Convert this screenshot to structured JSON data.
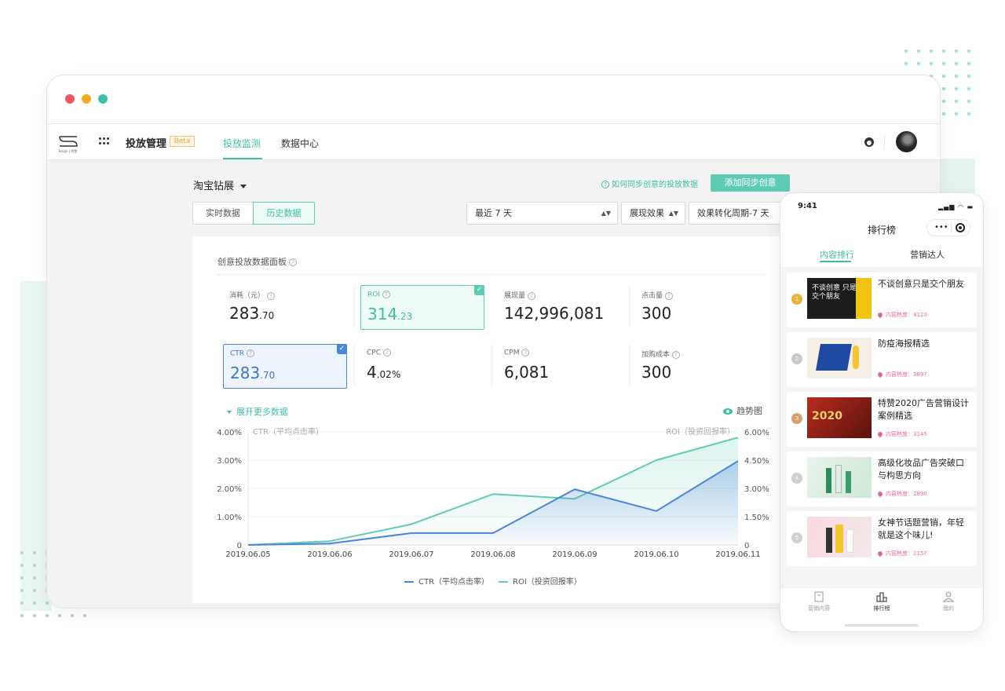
{
  "colors": {
    "accent": "#3cbfa4",
    "ctr_line": "#4a86da",
    "roi_line": "#5fcbb4",
    "heat": "#e46a8f"
  },
  "nav": {
    "brand": "投放管理",
    "badge": "Beta",
    "tabs": [
      {
        "label": "投放监测",
        "active": true
      },
      {
        "label": "数据中心",
        "active": false
      }
    ],
    "logo_text": "Tezign | 特赞"
  },
  "toolbar": {
    "store": "淘宝钻展",
    "help_link": "如何同步创意的投放数据",
    "add_button": "添加同步创意",
    "segments": [
      {
        "label": "实时数据",
        "active": false
      },
      {
        "label": "历史数据",
        "active": true
      }
    ],
    "selects": [
      "最近 7 天",
      "展现效果",
      "效果转化周期-7 天"
    ]
  },
  "panel": {
    "title": "创意投放数据面板",
    "metrics": [
      {
        "label": "消耗（元）",
        "int": "283",
        "dec": ".70",
        "state": "none"
      },
      {
        "label": "ROI",
        "int": "314",
        "dec": ".23",
        "state": "green"
      },
      {
        "label": "展现量",
        "int": "142,996,081",
        "dec": "",
        "state": "none"
      },
      {
        "label": "点击量",
        "int": "300",
        "dec": "",
        "state": "none"
      },
      {
        "label": "CTR",
        "int": "283",
        "dec": ".70",
        "state": "blue"
      },
      {
        "label": "CPC",
        "int": "4",
        "dec": ".02%",
        "state": "none"
      },
      {
        "label": "CPM",
        "int": "6,081",
        "dec": "",
        "state": "none"
      },
      {
        "label": "加购成本",
        "int": "300",
        "dec": "",
        "state": "none"
      }
    ],
    "expand_label": "展开更多数据",
    "trend_label": "趋势图"
  },
  "chart_data": {
    "type": "line",
    "x": [
      "2019.06.05",
      "2019.06.06",
      "2019.06.07",
      "2019.06.08",
      "2019.06.09",
      "2019.06.10",
      "2019.06.11"
    ],
    "series": [
      {
        "name": "CTR（平均点击率）",
        "axis": "left",
        "values": [
          0.0,
          0.05,
          0.42,
          0.42,
          1.97,
          1.2,
          2.97
        ]
      },
      {
        "name": "ROI（投资回报率）",
        "axis": "right",
        "values": [
          0.0,
          0.2,
          1.1,
          2.7,
          2.45,
          4.5,
          5.7
        ]
      }
    ],
    "ylabel_left": "CTR（平均点击率）",
    "ylabel_right": "ROI（投资回报率）",
    "yticks_left": [
      "0",
      "1.00%",
      "2.00%",
      "3.00%",
      "4.00%"
    ],
    "yticks_right": [
      "0",
      "1.50%",
      "3.00%",
      "4.50%",
      "6.00%"
    ],
    "ylim_left": [
      0,
      4
    ],
    "ylim_right": [
      0,
      6
    ],
    "grid": true,
    "legend": "bottom"
  },
  "phone": {
    "time": "9:41",
    "title": "排行榜",
    "capsule_more": "•••",
    "tabs": [
      {
        "label": "内容排行",
        "active": true
      },
      {
        "label": "营销达人",
        "active": false
      }
    ],
    "items": [
      {
        "rank": "1",
        "title": "不谈创意只是交个朋友",
        "heat": "内容热度：4120",
        "thumb_text": "不谈创意 只是交个朋友"
      },
      {
        "rank": "2",
        "title": "防疫海报精选",
        "heat": "内容热度：3897",
        "thumb_text": ""
      },
      {
        "rank": "3",
        "title": "特赞2020广告营销设计案例精选",
        "heat": "内容热度：3145",
        "thumb_text": "2020"
      },
      {
        "rank": "4",
        "title": "高级化妆品广告突破口与构思方向",
        "heat": "内容热度：2890",
        "thumb_text": ""
      },
      {
        "rank": "5",
        "title": "女神节话题营销，年轻就是这个味儿!",
        "heat": "内容热度：2157",
        "thumb_text": ""
      }
    ],
    "tabbar": [
      {
        "label": "营销内容",
        "active": false
      },
      {
        "label": "排行榜",
        "active": true
      },
      {
        "label": "我的",
        "active": false
      }
    ]
  }
}
